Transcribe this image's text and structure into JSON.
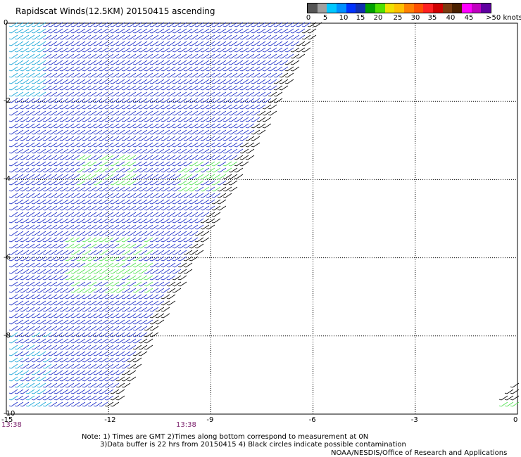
{
  "title": "Rapidscat Winds(12.5KM) 20150415 ascending",
  "colorbar": {
    "labels": [
      "0",
      "5",
      "10",
      "15",
      "20",
      "25",
      "30",
      "35",
      "40",
      "45",
      ">50 knots"
    ],
    "colors": [
      "#555555",
      "#a0a0a0",
      "#00c8ff",
      "#0090ff",
      "#0033ff",
      "#1030b0",
      "#00a000",
      "#50e000",
      "#f0e000",
      "#ffc000",
      "#ff8000",
      "#ff5000",
      "#ff2020",
      "#d00000",
      "#7a3a10",
      "#4a2000",
      "#ff00ff",
      "#c000c0",
      "#6000a0"
    ]
  },
  "axes": {
    "x_ticks": [
      "-15",
      "-12",
      "-9",
      "-6",
      "-3",
      "0"
    ],
    "y_ticks": [
      "0",
      "-2",
      "-4",
      "-6",
      "-8",
      "-10"
    ],
    "xlim": [
      -15,
      0
    ],
    "ylim": [
      -10,
      0
    ]
  },
  "times": [
    "13:38",
    "13:38"
  ],
  "notes": [
    "Note: 1) Times are GMT 2)Times along bottom correspond to measurement at 0N",
    "3)Data buffer is 22 hrs from 20150415 4) Black circles indicate possible contamination"
  ],
  "credit": "NOAA/NESDIS/Office of Research and Applications"
}
